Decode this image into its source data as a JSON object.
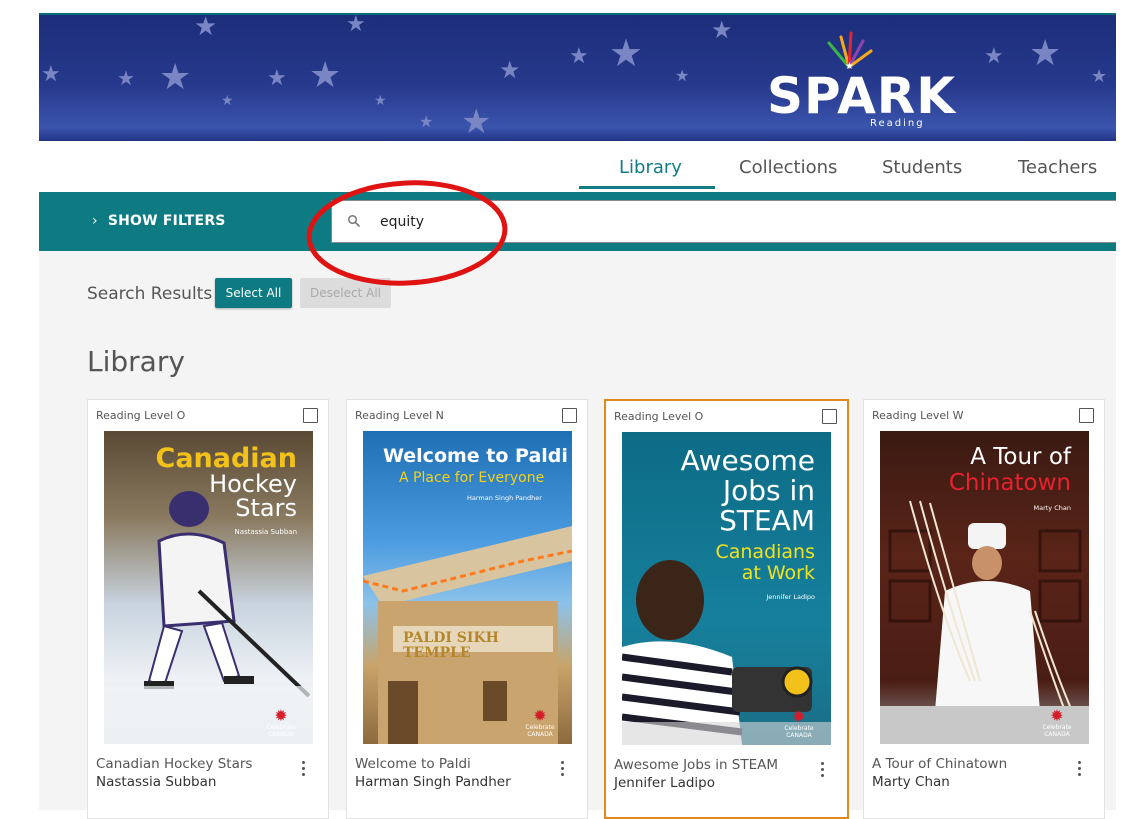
{
  "brand": {
    "logo_text": "SPARK",
    "logo_sub": "Reading",
    "colors": {
      "banner": "#27398c",
      "accent": "#0e7b82",
      "highlight": "#e08a1e"
    }
  },
  "nav": {
    "tabs": [
      {
        "label": "Library",
        "active": true
      },
      {
        "label": "Collections",
        "active": false
      },
      {
        "label": "Students",
        "active": false
      },
      {
        "label": "Teachers",
        "active": false
      }
    ]
  },
  "filters": {
    "toggle_label": "SHOW FILTERS",
    "toggle_icon": "chevron-right-icon",
    "search_icon": "search-icon",
    "search_value": "equity"
  },
  "results": {
    "label": "Search Results",
    "select_all": "Select All",
    "deselect_all": "Deselect All",
    "heading": "Library"
  },
  "books": [
    {
      "level": "Reading Level O",
      "title": "Canadian Hockey Stars",
      "author": "Nastassia Subban",
      "cover_lines": [
        "Canadian",
        "Hockey",
        "Stars"
      ],
      "cover_author": "Nastassia Subban",
      "badge": "Celebrate CANADA",
      "selected": false
    },
    {
      "level": "Reading Level N",
      "title": "Welcome to Paldi",
      "author": "Harman Singh Pandher",
      "cover_lines": [
        "Welcome to Paldi",
        "A Place for Everyone"
      ],
      "cover_author": "Harman Singh Pandher",
      "sign_text": "PALDI SIKH TEMPLE",
      "badge": "Celebrate CANADA",
      "selected": false
    },
    {
      "level": "Reading Level O",
      "title": "Awesome Jobs in STEAM",
      "author": "Jennifer Ladipo",
      "cover_lines": [
        "Awesome",
        "Jobs in",
        "STEAM",
        "Canadians",
        "at Work"
      ],
      "cover_author": "Jennifer Ladipo",
      "badge": "Celebrate CANADA",
      "selected": false,
      "highlighted": true
    },
    {
      "level": "Reading Level W",
      "title": "A Tour of Chinatown",
      "author": "Marty Chan",
      "cover_lines": [
        "A Tour of",
        "Chinatown"
      ],
      "cover_author": "Marty Chan",
      "badge": "Celebrate CANADA",
      "selected": false
    }
  ]
}
